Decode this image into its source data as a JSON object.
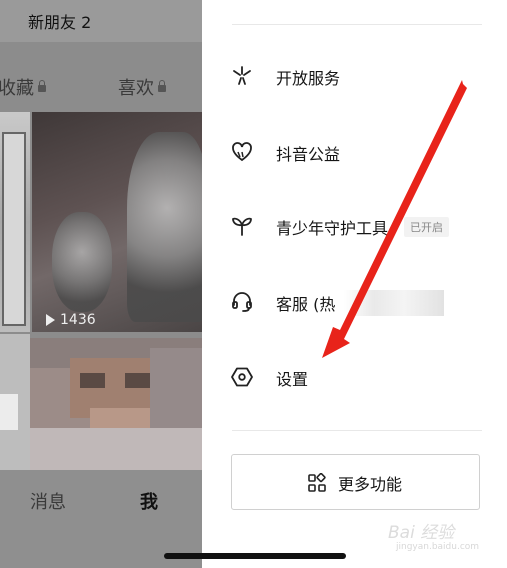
{
  "left_panel": {
    "new_friends": "新朋友 2",
    "tabs": [
      {
        "label": "收藏"
      },
      {
        "label": "喜欢"
      }
    ],
    "video_play_count": "1436",
    "bottom_nav": [
      {
        "label": "消息"
      },
      {
        "label": "我"
      }
    ]
  },
  "menu": {
    "items": [
      {
        "label": "开放服务",
        "icon": "open-service-icon"
      },
      {
        "label": "抖音公益",
        "icon": "charity-icon"
      },
      {
        "label": "青少年守护工具",
        "icon": "sprout-icon",
        "badge": "已开启"
      },
      {
        "label": "客服 (热",
        "icon": "headset-icon"
      },
      {
        "label": "设置",
        "icon": "settings-icon"
      }
    ],
    "more_button": {
      "label": "更多功能",
      "icon": "grid-icon"
    }
  },
  "annotation": {
    "color": "#e8231a"
  },
  "watermark": {
    "text": "Bai 经验",
    "sub": "jingyan.baidu.com"
  },
  "colors": {
    "accent": "#e8231a",
    "overlay": "#8c8c8c"
  }
}
